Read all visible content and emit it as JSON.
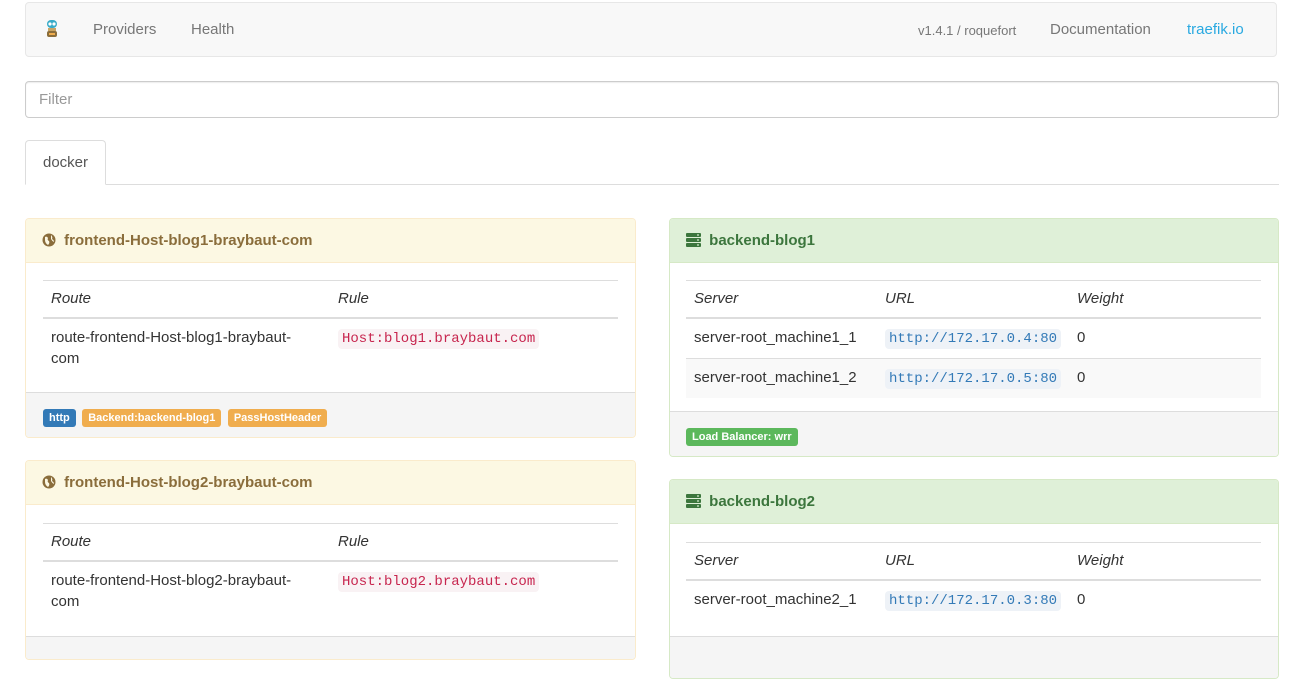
{
  "navbar": {
    "nav_items": [
      "Providers",
      "Health"
    ],
    "version": "v1.4.1 / roquefort",
    "documentation": "Documentation",
    "site_link": "traefik.io",
    "brand_color": "#29a9e1"
  },
  "filter": {
    "placeholder": "Filter",
    "value": ""
  },
  "tabs": [
    {
      "label": "docker",
      "active": true
    }
  ],
  "frontends": [
    {
      "name": "frontend-Host-blog1-braybaut-com",
      "icon": "globe-icon",
      "columns": [
        "Route",
        "Rule"
      ],
      "routes": [
        {
          "route": "route-frontend-Host-blog1-braybaut-com",
          "rule": "Host:blog1.braybaut.com"
        }
      ],
      "labels": [
        "http",
        "Backend:backend-blog1",
        "PassHostHeader"
      ]
    },
    {
      "name": "frontend-Host-blog2-braybaut-com",
      "icon": "globe-icon",
      "columns": [
        "Route",
        "Rule"
      ],
      "routes": [
        {
          "route": "route-frontend-Host-blog2-braybaut-com",
          "rule": "Host:blog2.braybaut.com"
        }
      ]
    }
  ],
  "backends": [
    {
      "name": "backend-blog1",
      "icon": "server-icon",
      "columns": [
        "Server",
        "URL",
        "Weight"
      ],
      "servers": [
        {
          "server": "server-root_machine1_1",
          "url": "http://172.17.0.4:80",
          "weight": "0"
        },
        {
          "server": "server-root_machine1_2",
          "url": "http://172.17.0.5:80",
          "weight": "0"
        }
      ],
      "load_balancer": "Load Balancer: wrr"
    },
    {
      "name": "backend-blog2",
      "icon": "server-icon",
      "columns": [
        "Server",
        "URL",
        "Weight"
      ],
      "servers": [
        {
          "server": "server-root_machine2_1",
          "url": "http://172.17.0.3:80",
          "weight": "0"
        }
      ]
    }
  ]
}
